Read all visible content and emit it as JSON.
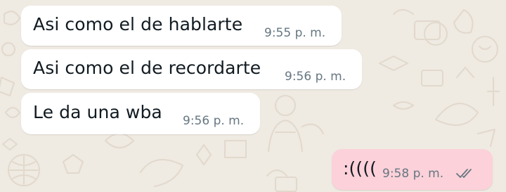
{
  "messages": [
    {
      "direction": "incoming",
      "text": "Asi como el de hablarte",
      "time": "9:55 p. m."
    },
    {
      "direction": "incoming",
      "text": "Asi como el de recordarte",
      "time": "9:56 p. m."
    },
    {
      "direction": "incoming",
      "text": "Le da una wba",
      "time": "9:56 p. m."
    },
    {
      "direction": "outgoing",
      "text": ":((((",
      "time": "9:58 p. m.",
      "status_icon": "double-check-icon"
    }
  ],
  "colors": {
    "background": "#efeae2",
    "incoming_bubble": "#ffffff",
    "outgoing_bubble": "#fcd1da",
    "timestamp": "#667781",
    "doodle": "#e2dcd2"
  }
}
